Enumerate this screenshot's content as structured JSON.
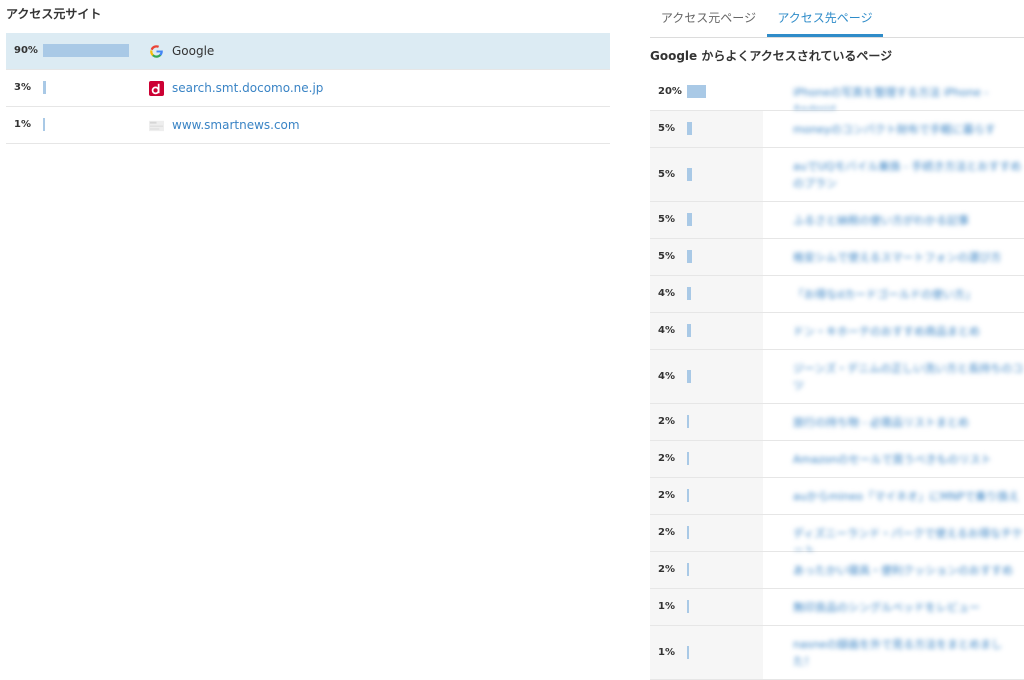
{
  "left": {
    "title": "アクセス元サイト",
    "sources": [
      {
        "pct": "90%",
        "value": 0.9,
        "label": "Google",
        "icon": "google-logo-icon",
        "selected": true
      },
      {
        "pct": "3%",
        "value": 0.03,
        "label": "search.smt.docomo.ne.jp",
        "icon": "docomo-d-icon",
        "selected": false
      },
      {
        "pct": "1%",
        "value": 0.01,
        "label": "www.smartnews.com",
        "icon": "smartnews-favicon-icon",
        "selected": false
      }
    ]
  },
  "right": {
    "tabs": [
      {
        "label": "アクセス元ページ",
        "active": false
      },
      {
        "label": "アクセス先ページ",
        "active": true
      }
    ],
    "subtitle": "Google からよくアクセスされているページ",
    "pages": [
      {
        "pct": "20%",
        "value": 0.2,
        "title": "iPhoneの写真を整理する方法 iPhone - Android",
        "lines": 1
      },
      {
        "pct": "5%",
        "value": 0.05,
        "title": "moneyのコンパクト財布で手軽に暮らす",
        "lines": 1
      },
      {
        "pct": "5%",
        "value": 0.05,
        "title": "auでUQモバイル乗換 - 手続き方法とおすすめのプラン",
        "lines": 2
      },
      {
        "pct": "5%",
        "value": 0.05,
        "title": "ふるさと納税の使い方がわかる記事",
        "lines": 1
      },
      {
        "pct": "5%",
        "value": 0.05,
        "title": "格安シムで使えるスマートフォンの選び方",
        "lines": 1
      },
      {
        "pct": "4%",
        "value": 0.04,
        "title": "「お得なdカードゴールドの使い方」",
        "lines": 1
      },
      {
        "pct": "4%",
        "value": 0.04,
        "title": "ドン・キホーテのおすすめ商品まとめ",
        "lines": 1
      },
      {
        "pct": "4%",
        "value": 0.04,
        "title": "ジーンズ・デニムの正しい洗い方と長持ちのコツ",
        "lines": 2
      },
      {
        "pct": "2%",
        "value": 0.02,
        "title": "旅行の持ち物 - 必需品リストまとめ",
        "lines": 1
      },
      {
        "pct": "2%",
        "value": 0.02,
        "title": "Amazonのセールで買うべきものリスト",
        "lines": 1
      },
      {
        "pct": "2%",
        "value": 0.02,
        "title": "auからmineo「マイネオ」にMNPで乗り換え",
        "lines": 1
      },
      {
        "pct": "2%",
        "value": 0.02,
        "title": "ディズニーランド・パークで使えるお得なチケット",
        "lines": 1
      },
      {
        "pct": "2%",
        "value": 0.02,
        "title": "あったかい寝具・便利クッションのおすすめ",
        "lines": 1
      },
      {
        "pct": "1%",
        "value": 0.01,
        "title": "無印良品のシングルベッドをレビュー",
        "lines": 1
      },
      {
        "pct": "1%",
        "value": 0.01,
        "title": "nasneの録画を外で見る方法をまとめました！",
        "lines": 2
      }
    ]
  },
  "colors": {
    "bar": "#a9c9e6",
    "link": "#3a84c5",
    "accent": "#2f8cc9",
    "selected_row": "#dcebf3"
  }
}
